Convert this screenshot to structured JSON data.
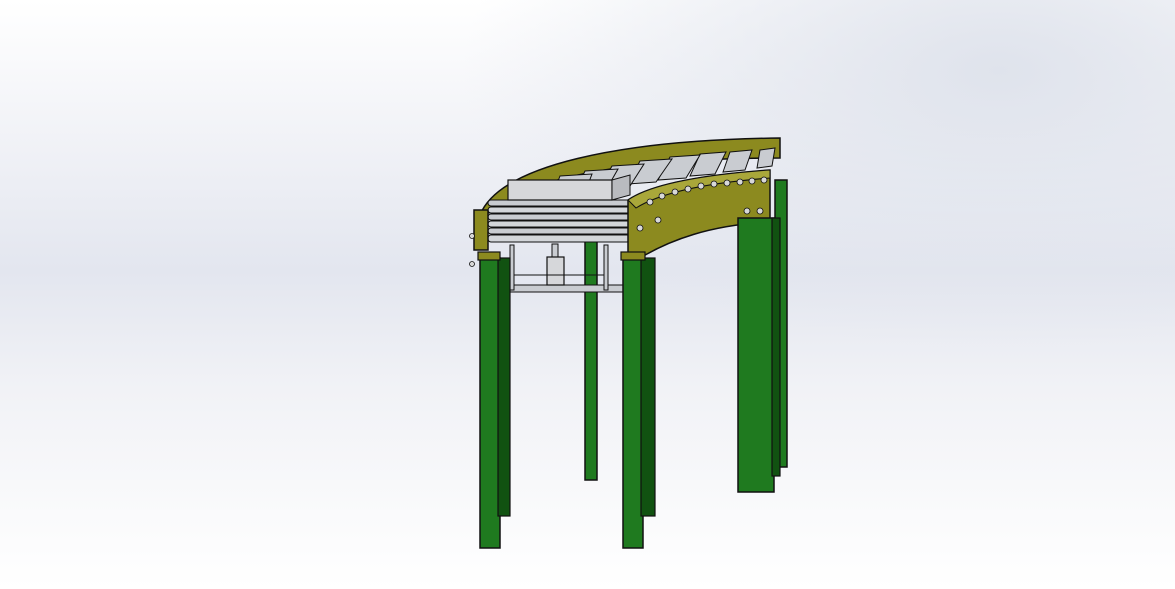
{
  "scene": {
    "model": "curved-roller-conveyor",
    "colors": {
      "leg": "#1f7a1f",
      "leg_dark": "#115211",
      "leg_light": "#2f9a2f",
      "frame": "#8c8a1f",
      "frame_dark": "#5e5c12",
      "frame_light": "#a9a73a",
      "roller": "#c9ccd1",
      "roller_dark": "#8e9297",
      "outline": "#111111",
      "bolt": "#d8d8d8"
    }
  }
}
